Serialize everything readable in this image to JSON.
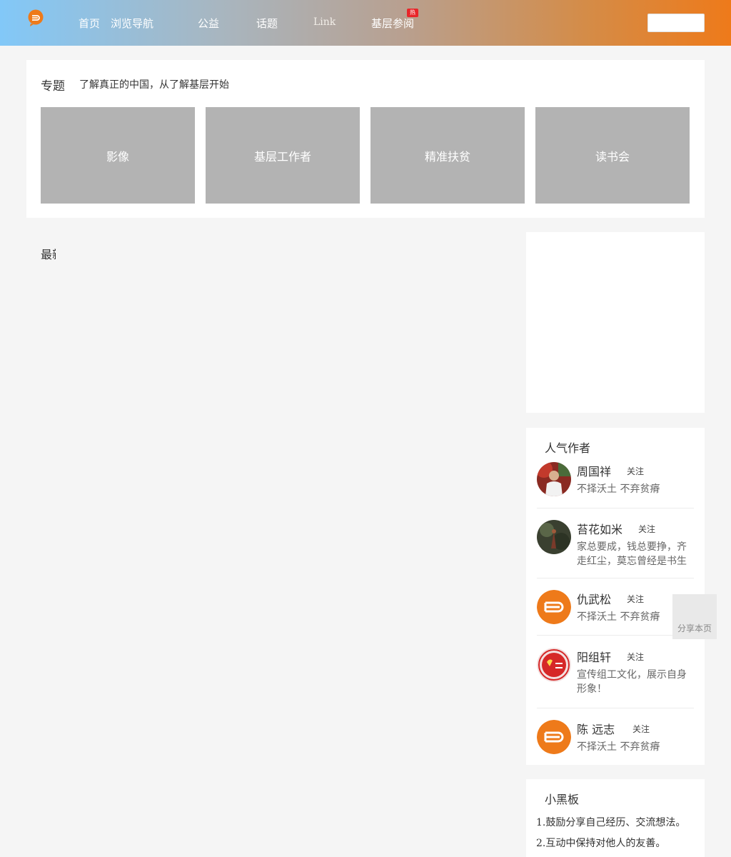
{
  "header": {
    "nav": [
      "首页",
      "浏览导航",
      "公益",
      "话题",
      "Link",
      "基层参阅"
    ],
    "hot_badge": "热",
    "search": {
      "value": "",
      "placeholder": ""
    },
    "colors": {
      "gradient_start": "#82c8f8",
      "gradient_end": "#ee7a1a",
      "logo": "#ee7a1a"
    }
  },
  "topics": {
    "heading": "专题",
    "subtitle": "了解真正的中国，从了解基层开始",
    "tiles": [
      "影像",
      "基层工作者",
      "精准扶贫",
      "读书会"
    ]
  },
  "latest": {
    "title": "最新"
  },
  "sidebar": {
    "authors": {
      "heading": "人气作者",
      "follow_label": "关注",
      "items": [
        {
          "name": "周国祥",
          "desc": "不择沃土 不弃贫瘠",
          "avatar_icon": "photo-avatar"
        },
        {
          "name": "苔花如米",
          "desc": "家总要成，钱总要挣，齐走红尘，莫忘曾经是书生",
          "avatar_icon": "photo-avatar"
        },
        {
          "name": "仇武松",
          "desc": "不择沃土 不弃贫瘠",
          "avatar_icon": "default-logo-avatar"
        },
        {
          "name": "阳组轩",
          "desc": "宣传组工文化，展示自身形象！",
          "avatar_icon": "party-emblem-avatar"
        },
        {
          "name": "陈 远志",
          "desc": "不择沃土 不弃贫瘠",
          "avatar_icon": "default-logo-avatar"
        }
      ]
    },
    "board": {
      "heading": "小黑板",
      "items": [
        "鼓励分享自己经历、交流想法。",
        "互动中保持对他人的友善。"
      ]
    }
  },
  "share": {
    "label": "分享本页"
  }
}
